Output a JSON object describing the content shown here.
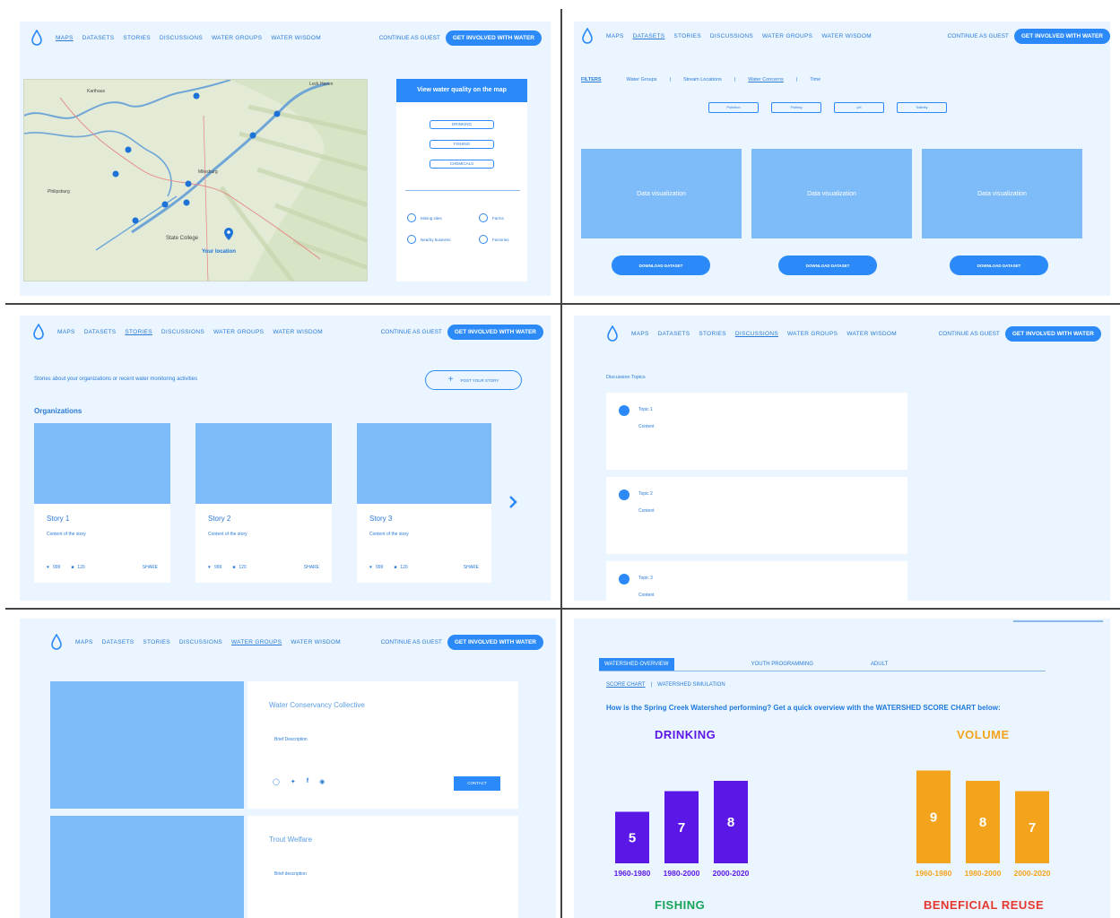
{
  "nav": {
    "links": [
      "MAPS",
      "DATASETS",
      "STORIES",
      "DISCUSSIONS",
      "WATER GROUPS",
      "WATER WISDOM"
    ],
    "guest": "CONTINUE AS GUEST",
    "cta": "GET INVOLVED WITH WATER"
  },
  "colors": {
    "accent": "#2b8af7",
    "card_blue": "#7ebcf9",
    "background": "#eaf5ff",
    "purple": "#5a17e6",
    "orange": "#f4a31c"
  },
  "maps": {
    "card_title": "View water quality on the map",
    "options": [
      "DRINKING",
      "FISHING",
      "CHEMICALS"
    ],
    "legend": [
      "Mining sites",
      "Farms",
      "Nearby business",
      "Factories"
    ],
    "place_labels": {
      "lock_haven": "Lock Haven",
      "karthaus": "Karthaus",
      "milesburg": "Milesburg",
      "philipsburg": "Philipsburg",
      "state_college": "State College",
      "your_location": "Your location"
    }
  },
  "datasets": {
    "filters_label": "FILTERS",
    "filters": [
      "Water Groups",
      "Stream Locations",
      "Water Concerns",
      "Time"
    ],
    "chips": [
      "Pollution",
      "Fishing",
      "pH",
      "Salinity"
    ],
    "viz_label": "Data visualization",
    "download_label": "DOWNLOAD DATASET"
  },
  "stories": {
    "intro": "Stories about your organizations or recent water monitoring activities",
    "post_button": "POST YOUR STORY",
    "section": "Organizations",
    "cards": [
      {
        "title": "Story 1",
        "content": "Content of the story",
        "likes": "999",
        "comments": "120",
        "share": "SHARE"
      },
      {
        "title": "Story 2",
        "content": "Content of the story",
        "likes": "999",
        "comments": "120",
        "share": "SHARE"
      },
      {
        "title": "Story 3",
        "content": "Content of the story",
        "likes": "999",
        "comments": "120",
        "share": "SHARE"
      }
    ]
  },
  "discussions": {
    "section": "Discussion Topics",
    "topics": [
      {
        "title": "Topic 1",
        "content": "Content"
      },
      {
        "title": "Topic 2",
        "content": "Content"
      },
      {
        "title": "Topic 3",
        "content": "Content"
      }
    ]
  },
  "groups": {
    "items": [
      {
        "name": "Water Conservancy Collective",
        "desc": "Brief Description"
      },
      {
        "name": "Trout Welfare",
        "desc": "Brief description"
      }
    ],
    "contact": "CONTACT"
  },
  "score": {
    "tabs": [
      "WATERSHED OVERVIEW",
      "YOUTH PROGRAMMING",
      "ADULT"
    ],
    "subnav": [
      "SCORE CHART",
      "WATERSHED SIMULATION"
    ],
    "question": "How is the Spring Creek Watershed performing? Get a quick overview with the WATERSHED SCORE CHART below:",
    "lower_titles": [
      "FISHING",
      "BENEFICIAL REUSE"
    ]
  },
  "chart_data": [
    {
      "type": "bar",
      "title": "DRINKING",
      "categories": [
        "1960-1980",
        "1980-2000",
        "2000-2020"
      ],
      "values": [
        5,
        7,
        8
      ],
      "ylim": [
        0,
        10
      ],
      "color": "#5a17e6",
      "legend": "none",
      "grid": false
    },
    {
      "type": "bar",
      "title": "VOLUME",
      "categories": [
        "1960-1980",
        "1980-2000",
        "2000-2020"
      ],
      "values": [
        9,
        8,
        7
      ],
      "ylim": [
        0,
        10
      ],
      "color": "#f4a31c",
      "legend": "none",
      "grid": false
    }
  ]
}
